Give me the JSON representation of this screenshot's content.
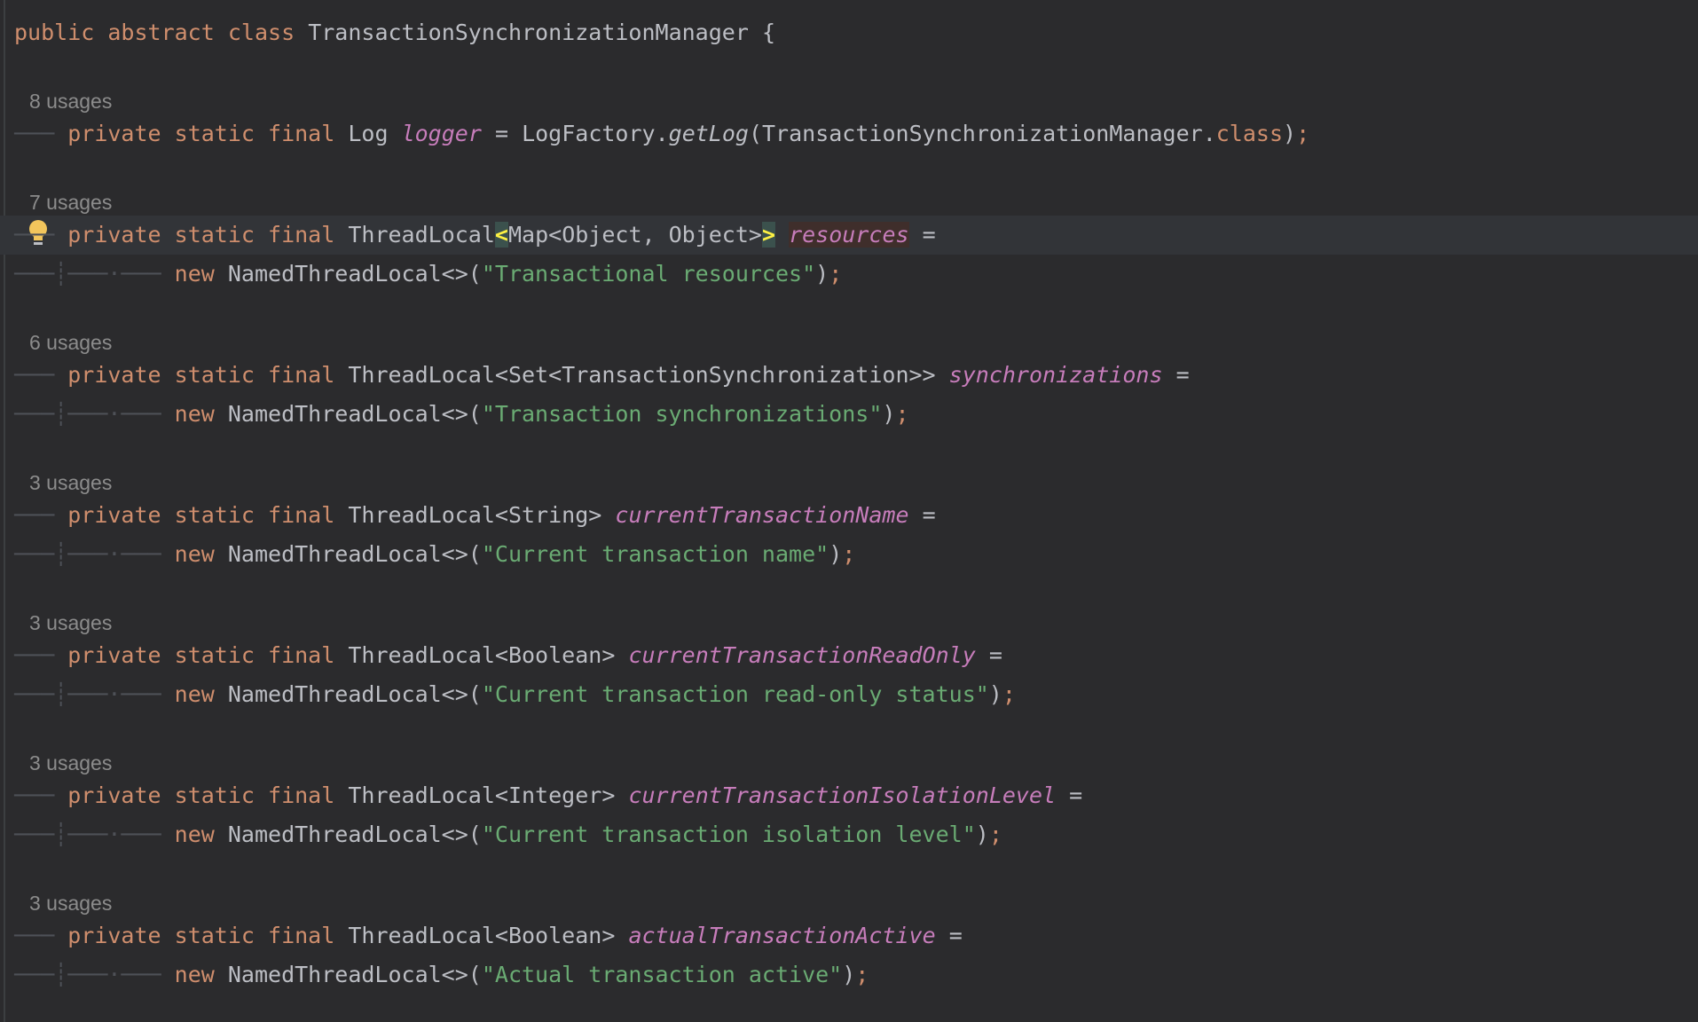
{
  "class_decl": {
    "kw_public": "public",
    "kw_abstract": "abstract",
    "kw_class": "class",
    "name": "TransactionSynchronizationManager",
    "brace": "{"
  },
  "common": {
    "private": "private",
    "static": "static",
    "final": "final",
    "new": "new",
    "eq": "=",
    "guide_short": "───",
    "guide_long": "───┊───·───"
  },
  "fields": [
    {
      "usages": "8 usages",
      "type": "Log",
      "name": "logger",
      "init_prefix": "LogFactory.",
      "init_method": "getLog",
      "init_args": "(TransactionSynchronizationManager.",
      "init_class_kw": "class",
      "init_close": ")",
      "semi": ";"
    },
    {
      "usages": "7 usages",
      "type_prefix": "ThreadLocal",
      "type_open": "<",
      "type_inner": "Map<Object, Object>",
      "type_close": ">",
      "name": "resources",
      "ctor": "NamedThreadLocal<>(",
      "str": "\"Transactional resources\"",
      "close": ")",
      "semi": ";"
    },
    {
      "usages": "6 usages",
      "type": "ThreadLocal<Set<TransactionSynchronization>>",
      "name": "synchronizations",
      "ctor": "NamedThreadLocal<>(",
      "str": "\"Transaction synchronizations\"",
      "close": ")",
      "semi": ";"
    },
    {
      "usages": "3 usages",
      "type": "ThreadLocal<String>",
      "name": "currentTransactionName",
      "ctor": "NamedThreadLocal<>(",
      "str": "\"Current transaction name\"",
      "close": ")",
      "semi": ";"
    },
    {
      "usages": "3 usages",
      "type": "ThreadLocal<Boolean>",
      "name": "currentTransactionReadOnly",
      "ctor": "NamedThreadLocal<>(",
      "str": "\"Current transaction read-only status\"",
      "close": ")",
      "semi": ";"
    },
    {
      "usages": "3 usages",
      "type": "ThreadLocal<Integer>",
      "name": "currentTransactionIsolationLevel",
      "ctor": "NamedThreadLocal<>(",
      "str": "\"Current transaction isolation level\"",
      "close": ")",
      "semi": ";"
    },
    {
      "usages": "3 usages",
      "type": "ThreadLocal<Boolean>",
      "name": "actualTransactionActive",
      "ctor": "NamedThreadLocal<>(",
      "str": "\"Actual transaction active\"",
      "close": ")",
      "semi": ";"
    }
  ],
  "icons": {
    "intention": "lightbulb-icon"
  },
  "colors": {
    "background": "#2b2b2d",
    "keyword": "#cf8e6d",
    "field": "#c77dbb",
    "string": "#6aab73",
    "text": "#bcbec4",
    "usages": "#8c8c8c",
    "bulb": "#f2c55c"
  }
}
